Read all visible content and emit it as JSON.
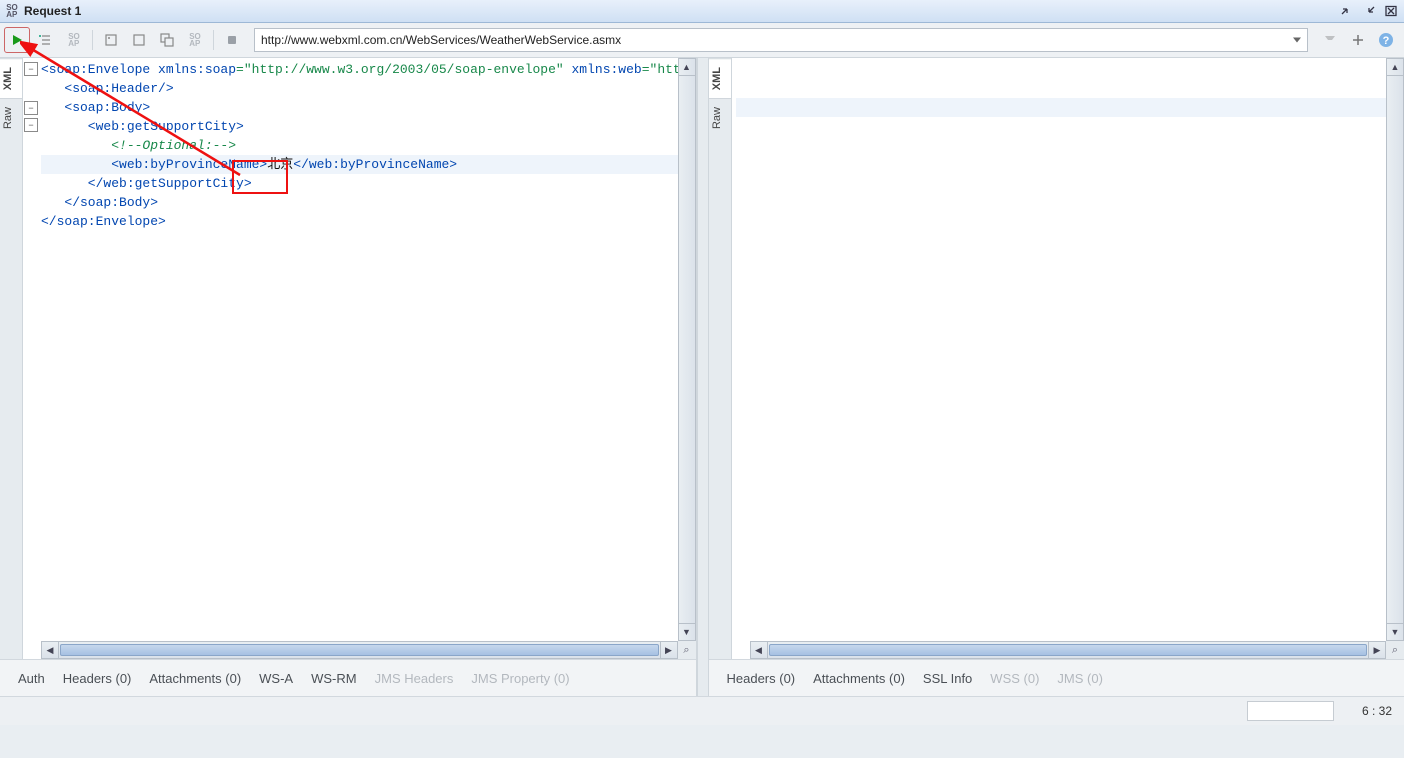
{
  "window": {
    "title": "Request 1",
    "soap_icon": "SO\nAP"
  },
  "toolbar": {
    "url": "http://www.webxml.com.cn/WebServices/WeatherWebService.asmx"
  },
  "side_tabs": {
    "xml": "XML",
    "raw": "Raw"
  },
  "xml": {
    "line1_pre": "<soap:Envelope",
    "line1_ns1_attr": " xmlns:soap",
    "line1_ns1_val": "=\"http://www.w3.org/2003/05/soap-envelope\"",
    "line1_ns2_attr": " xmlns:web",
    "line1_ns2_val": "=\"http://WebXml.com.cn/\"",
    "line1_end": ">",
    "line2": "   <soap:Header/>",
    "line3": "   <soap:Body>",
    "line4": "      <web:getSupportCity>",
    "line5": "         <!--Optional:-->",
    "line6_open": "         <web:byProvinceName>",
    "line6_value": "北京",
    "line6_close": "</web:byProvinceName>",
    "line7": "      </web:getSupportCity>",
    "line8": "   </soap:Body>",
    "line9": "</soap:Envelope>"
  },
  "tabs_left": {
    "auth": "Auth",
    "headers": "Headers (0)",
    "attachments": "Attachments (0)",
    "wsa": "WS-A",
    "wsrm": "WS-RM",
    "jms_headers": "JMS Headers",
    "jms_prop": "JMS Property (0)"
  },
  "tabs_right": {
    "headers": "Headers (0)",
    "attachments": "Attachments (0)",
    "ssl": "SSL Info",
    "wss": "WSS (0)",
    "jms": "JMS (0)"
  },
  "status": {
    "position": "6 : 32"
  }
}
